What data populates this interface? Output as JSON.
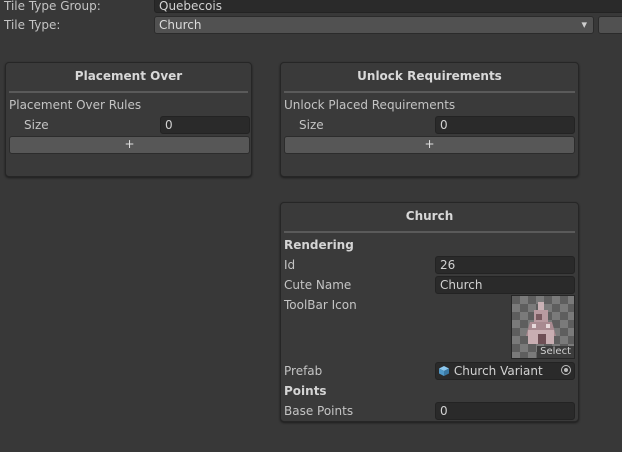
{
  "header": {
    "tile_type_group_label": "Tile Type Group:",
    "tile_type_group_value": "Quebecois",
    "tile_type_label": "Tile Type:",
    "tile_type_value": "Church",
    "dropdown_arrow": "▾"
  },
  "placement_over": {
    "title": "Placement Over",
    "rules_label": "Placement Over Rules",
    "size_label": "Size",
    "size_value": "0",
    "add_label": "+"
  },
  "unlock_requirements": {
    "title": "Unlock Requirements",
    "rules_label": "Unlock Placed Requirements",
    "size_label": "Size",
    "size_value": "0",
    "add_label": "+"
  },
  "church": {
    "title": "Church",
    "rendering_header": "Rendering",
    "id_label": "Id",
    "id_value": "26",
    "cute_name_label": "Cute Name",
    "cute_name_value": "Church",
    "toolbar_icon_label": "ToolBar Icon",
    "select_label": "Select",
    "prefab_label": "Prefab",
    "prefab_value": "Church Variant",
    "points_header": "Points",
    "base_points_label": "Base Points",
    "base_points_value": "0"
  },
  "icons": {
    "dropdown": "chevron-down-icon",
    "prefab": "cube-prefab-icon",
    "object_picker": "object-picker-icon",
    "toolbar_sprite": "church-sprite-icon"
  },
  "colors": {
    "background": "#383838",
    "panel": "#3a3a3a",
    "field": "#2a2a2a",
    "prefab_cube": "#5aa6d6"
  }
}
